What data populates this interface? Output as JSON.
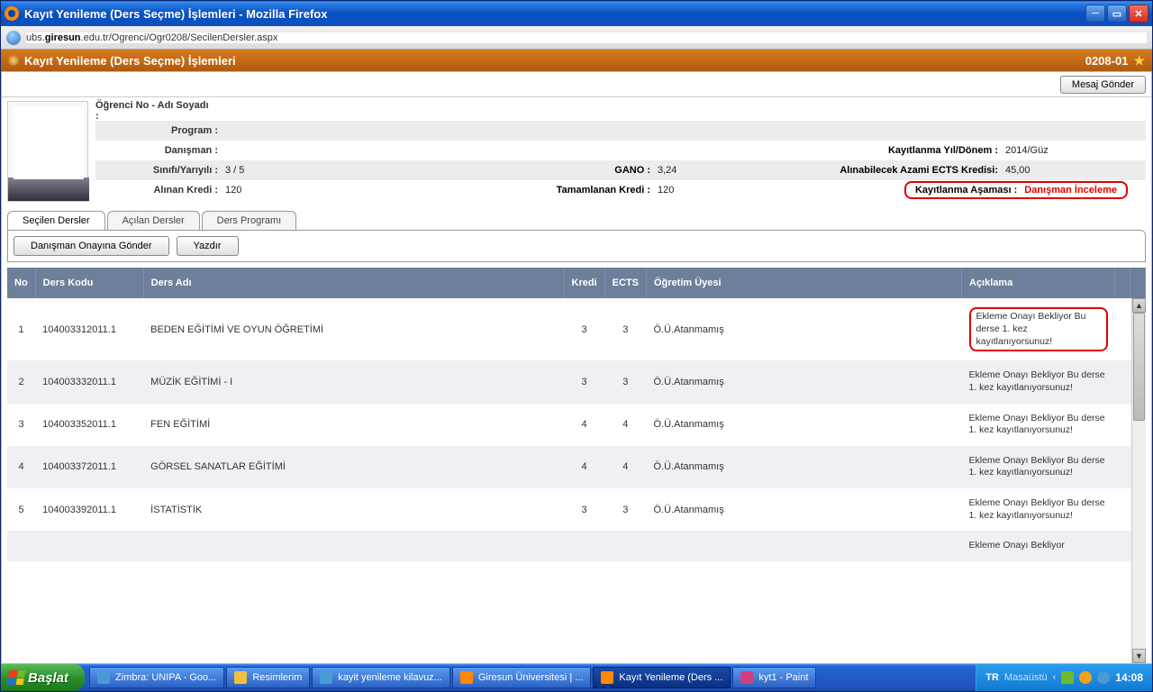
{
  "window": {
    "title": "Kayıt Yenileme (Ders Seçme) İşlemleri - Mozilla Firefox",
    "url_prefix": "ubs.",
    "url_domain": "giresun",
    "url_suffix": ".edu.tr/Ogrenci/Ogr0208/SecilenDersler.aspx"
  },
  "page": {
    "header_title": "Kayıt Yenileme (Ders Seçme) İşlemleri",
    "header_code": "0208-01",
    "mesaj_button": "Mesaj Gönder"
  },
  "info": {
    "labels": {
      "ogrenci": "Öğrenci No - Adı Soyadı :",
      "program": "Program :",
      "danisman": "Danışman :",
      "sinif": "Sınıfı/Yarıyılı :",
      "alinan": "Alınan Kredi :",
      "gano": "GANO :",
      "tamamlanan": "Tamamlanan Kredi :",
      "kayit_yil": "Kayıtlanma Yıl/Dönem :",
      "azami": "Alınabilecek Azami ECTS Kredisi:",
      "asama": "Kayıtlanma Aşaması :"
    },
    "values": {
      "sinif": "3 / 5",
      "alinan": "120",
      "gano": "3,24",
      "tamamlanan": "120",
      "kayit_yil": "2014/Güz",
      "azami": "45,00",
      "asama": "Danışman İnceleme"
    }
  },
  "tabs": {
    "secilen": "Seçilen Dersler",
    "acilan": "Açılan Dersler",
    "program": "Ders Programı"
  },
  "actions": {
    "gonder": "Danışman Onayına Gönder",
    "yazdir": "Yazdır"
  },
  "table": {
    "headers": {
      "no": "No",
      "kod": "Ders Kodu",
      "ad": "Ders Adı",
      "kredi": "Kredi",
      "ects": "ECTS",
      "ogretim": "Öğretim Üyesi",
      "aciklama": "Açıklama"
    },
    "rows": [
      {
        "no": "1",
        "kod": "104003312011.1",
        "ad": "BEDEN EĞİTİMİ VE OYUN ÖĞRETİMİ",
        "kredi": "3",
        "ects": "3",
        "ogr": "Ö.Ü.Atanmamış",
        "acik": "Ekleme Onayı Bekliyor Bu derse 1. kez kayıtlanıyorsunuz!"
      },
      {
        "no": "2",
        "kod": "104003332011.1",
        "ad": "MÜZİK EĞİTİMİ - I",
        "kredi": "3",
        "ects": "3",
        "ogr": "Ö.Ü.Atanmamış",
        "acik": "Ekleme Onayı Bekliyor Bu derse 1. kez kayıtlanıyorsunuz!"
      },
      {
        "no": "3",
        "kod": "104003352011.1",
        "ad": "FEN EĞİTİMİ",
        "kredi": "4",
        "ects": "4",
        "ogr": "Ö.Ü.Atanmamış",
        "acik": "Ekleme Onayı Bekliyor Bu derse 1. kez kayıtlanıyorsunuz!"
      },
      {
        "no": "4",
        "kod": "104003372011.1",
        "ad": "GÖRSEL SANATLAR EĞİTİMİ",
        "kredi": "4",
        "ects": "4",
        "ogr": "Ö.Ü.Atanmamış",
        "acik": "Ekleme Onayı Bekliyor Bu derse 1. kez kayıtlanıyorsunuz!"
      },
      {
        "no": "5",
        "kod": "104003392011.1",
        "ad": "İSTATİSTİK",
        "kredi": "3",
        "ects": "3",
        "ogr": "Ö.Ü.Atanmamış",
        "acik": "Ekleme Onayı Bekliyor Bu derse 1. kez kayıtlanıyorsunuz!"
      }
    ],
    "partial_next": "Ekleme Onayı Bekliyor"
  },
  "taskbar": {
    "start": "Başlat",
    "items": [
      "Zimbra: UNIPA - Goo...",
      "Resimlerim",
      "kayit yenileme kilavuz...",
      "Giresun Üniversitesi | ...",
      "Kayıt Yenileme (Ders ...",
      "kyt1 - Paint"
    ],
    "lang": "TR",
    "desk": "Masaüstü",
    "clock": "14:08"
  }
}
